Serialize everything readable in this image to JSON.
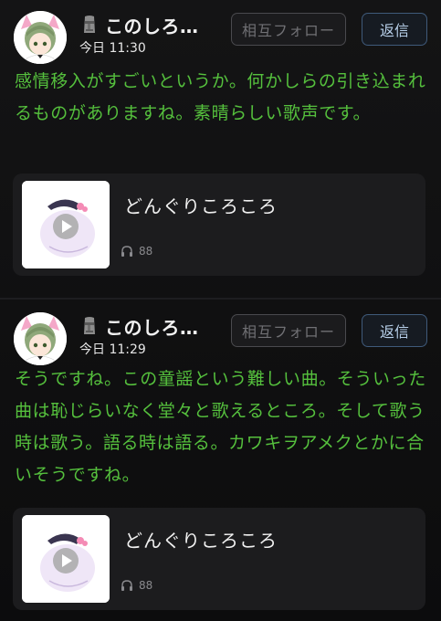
{
  "posts": [
    {
      "username": "このしろ…",
      "timestamp": "今日 11:30",
      "follow_label": "相互フォロー",
      "reply_label": "返信",
      "text": "感情移入がすごいというか。何かしらの引き込まれるものがありますね。素晴らしい歌声です。",
      "song": {
        "title": "どんぐりころころ",
        "plays": "88"
      }
    },
    {
      "username": "このしろ…",
      "timestamp": "今日 11:29",
      "follow_label": "相互フォロー",
      "reply_label": "返信",
      "text": "そうですね。この童謡という難しい曲。そういった曲は恥じらいなく堂々と歌えるところ。そして歌う時は歌う。語る時は語る。カワキヲアメクとかに合いそうですね。",
      "song": {
        "title": "どんぐりころころ",
        "plays": "88"
      }
    }
  ],
  "colors": {
    "background": "#0d0d0e",
    "post_text": "#55c03d",
    "card_bg": "#1c1c1e",
    "follow_border": "#4a4a4e",
    "reply_border": "#3f5a7a",
    "reply_text": "#b8d0ea"
  },
  "icons": {
    "status_emoji": "moai-icon",
    "plays": "headphones-icon",
    "play": "play-icon"
  }
}
